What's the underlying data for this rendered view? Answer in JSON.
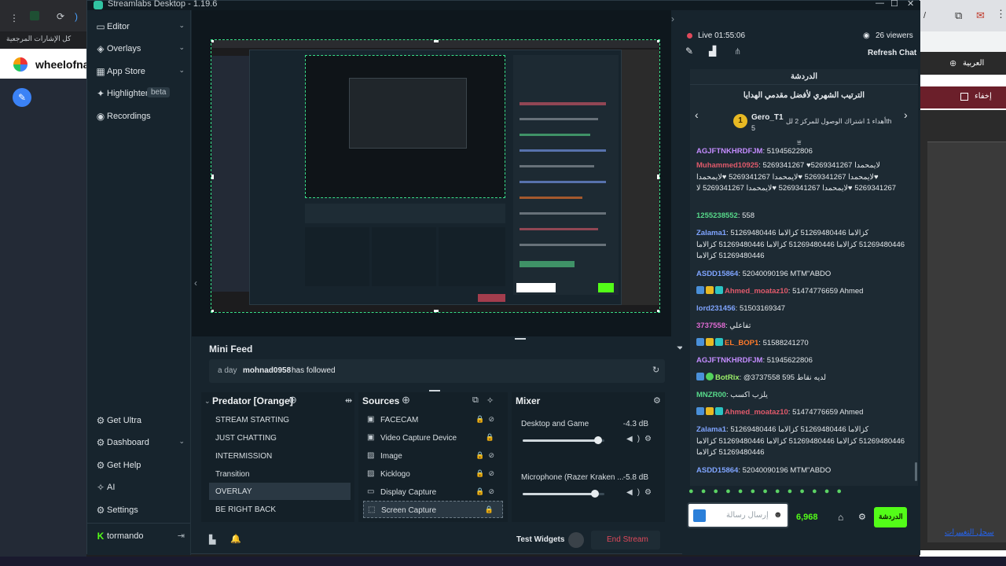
{
  "browser": {
    "bookmarks_label": "كل الإشارات المرجعية",
    "site_title": "wheelofna",
    "right_lang": "العربية",
    "right_checkbox_label": "إخفاء",
    "right_link": "سجل التغييرات"
  },
  "app": {
    "title": "Streamlabs Desktop - 1.19.6",
    "nav": [
      {
        "label": "Editor",
        "icon": "editor-icon",
        "chevron": true
      },
      {
        "label": "Overlays",
        "icon": "overlays-icon",
        "chevron": true
      },
      {
        "label": "App Store",
        "icon": "app-store-icon",
        "chevron": true
      },
      {
        "label": "Highlighter",
        "icon": "highlighter-icon",
        "badge": "beta"
      },
      {
        "label": "Recordings",
        "icon": "recordings-icon"
      }
    ],
    "nav_bottom": [
      {
        "label": "Get Ultra",
        "icon": "ultra-icon"
      },
      {
        "label": "Dashboard",
        "icon": "dashboard-icon",
        "chevron": true
      },
      {
        "label": "Get Help",
        "icon": "help-icon"
      },
      {
        "label": "AI",
        "icon": "ai-icon"
      },
      {
        "label": "Settings",
        "icon": "settings-icon"
      }
    ],
    "user": {
      "name": "tormando"
    }
  },
  "mini_feed": {
    "title": "Mini Feed",
    "event": {
      "time": "a day",
      "user": "mohnad0958",
      "action": "has followed"
    }
  },
  "scenes": {
    "title": "Predator [Orange]",
    "items": [
      "STREAM STARTING",
      "JUST CHATTING",
      "INTERMISSION",
      "Transition",
      "OVERLAY",
      "BE RIGHT BACK"
    ],
    "active_index": 4
  },
  "sources": {
    "title": "Sources",
    "items": [
      {
        "label": "FACECAM",
        "icon": "camera-icon"
      },
      {
        "label": "Video Capture Device",
        "icon": "camera-icon"
      },
      {
        "label": "Image",
        "icon": "image-icon"
      },
      {
        "label": "Kicklogo",
        "icon": "image-icon"
      },
      {
        "label": "Display Capture",
        "icon": "display-icon"
      },
      {
        "label": "Screen Capture",
        "icon": "screen-icon"
      }
    ],
    "active_index": 5
  },
  "mixer": {
    "title": "Mixer",
    "channels": [
      {
        "name": "Desktop and Game",
        "db": "-4.3 dB",
        "level": 0.92
      },
      {
        "name": "Microphone (Razer Kraken ...",
        "db": "-5.8 dB",
        "level": 0.88
      }
    ]
  },
  "footer": {
    "test_widgets": "Test Widgets",
    "end_stream": "End Stream"
  },
  "chat": {
    "live": "Live 01:55:06",
    "viewers": "26 viewers",
    "refresh": "Refresh Chat",
    "header": "الدردشة",
    "leaderboard_title": "الترتيب الشهري لأفضل مقدمي الهدايا",
    "top_user": "Gero_T1",
    "top_rank": "1",
    "top_count": "5",
    "gift_text": "أهداء 1 اشتراك الوصول للمركز 2 للth",
    "messages": [
      {
        "user": "AGJFTNKHRDFJM",
        "color": "purple",
        "text": "51945622806"
      },
      {
        "user": "Muhammed10925",
        "color": "red",
        "text": "5269341267 ♥لايمحمدا 5269341267 ♥لايمحمدا 5269341267 ♥لايمحمدا 5269341267 ♥لايمحمدا 5269341267 ♥لايمحمدا 5269341267 ♥لايمحمدا 5269341267 لا"
      },
      {
        "user": "1255238552",
        "color": "green",
        "text": "558"
      },
      {
        "user": "Zalama1",
        "color": "blue",
        "text": "51269480446 كزالاما 51269480446 كزالاما 51269480446 كزالاما 51269480446 كزالاما 51269480446 كزالاما 51269480446 كزالاما"
      },
      {
        "user": "ASDD15864",
        "color": "blue",
        "text": "52040090196 MTM\"ABDO"
      },
      {
        "user": "Ahmed_moataz10",
        "color": "red",
        "text": "51474776659 Ahmed"
      },
      {
        "user": "lord231456",
        "color": "blue",
        "text": "51503169347"
      },
      {
        "user": "3737558",
        "color": "pink",
        "text": "تفاعلي"
      },
      {
        "user": "EL_BOP1",
        "color": "orange",
        "text": "51588241270"
      },
      {
        "user": "AGJFTNKHRDFJM",
        "color": "purple",
        "text": "51945622806"
      },
      {
        "user": "BotRix",
        "color": "lime",
        "text": "@3737558 595 لديه نقاط"
      },
      {
        "user": "MNZR00",
        "color": "green",
        "text": "يلزب اكسب"
      },
      {
        "user": "Ahmed_moataz10",
        "color": "red",
        "text": "51474776659 Ahmed"
      },
      {
        "user": "Zalama1",
        "color": "blue",
        "text": "51269480446 كزالاما 51269480446 كزالاما 51269480446 كزالاما 51269480446 كزالاما 51269480446 كزالاما 51269480446 كزالاما"
      },
      {
        "user": "ASDD15864",
        "color": "blue",
        "text": "52040090196 MTM\"ABDO"
      }
    ],
    "input_placeholder": "إرسال رسالة",
    "points": "6,968",
    "send_label": "الدردشة"
  },
  "colors": {
    "accent": "#31c3a2",
    "kick_green": "#53fc18",
    "selection": "#39e08a",
    "end_stream": "#e0495b"
  }
}
